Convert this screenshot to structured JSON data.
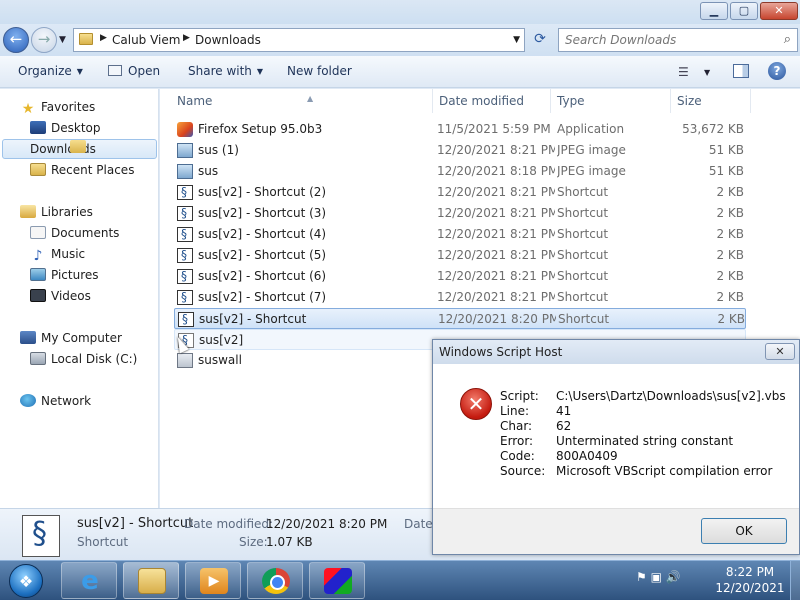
{
  "window": {
    "minimize_glyph": "▁",
    "maximize_glyph": "▢",
    "close_glyph": "✕"
  },
  "address": {
    "crumbs": [
      "Calub Viem",
      "Downloads"
    ],
    "refresh_glyph": "⟳",
    "search_placeholder": "Search Downloads"
  },
  "toolbar": {
    "organize": "Organize",
    "open": "Open",
    "share_with": "Share with",
    "new_folder": "New folder",
    "help_glyph": "?"
  },
  "nav": {
    "favorites": "Favorites",
    "desktop": "Desktop",
    "downloads": "Downloads",
    "recent_places": "Recent Places",
    "libraries": "Libraries",
    "documents": "Documents",
    "music": "Music",
    "pictures": "Pictures",
    "videos": "Videos",
    "my_computer": "My Computer",
    "local_disk": "Local Disk (C:)",
    "network": "Network"
  },
  "columns": {
    "name": "Name",
    "date_modified": "Date modified",
    "type": "Type",
    "size": "Size"
  },
  "files": [
    {
      "name": "Firefox Setup 95.0b3",
      "date": "11/5/2021 5:59 PM",
      "type": "Application",
      "size": "53,672 KB",
      "icon": "firefox-setup-icon"
    },
    {
      "name": "sus (1)",
      "date": "12/20/2021 8:21 PM",
      "type": "JPEG image",
      "size": "51 KB",
      "icon": "jpeg-file-icon"
    },
    {
      "name": "sus",
      "date": "12/20/2021 8:18 PM",
      "type": "JPEG image",
      "size": "51 KB",
      "icon": "jpeg-file-icon"
    },
    {
      "name": "sus[v2] - Shortcut (2)",
      "date": "12/20/2021 8:21 PM",
      "type": "Shortcut",
      "size": "2 KB",
      "icon": "shortcut-script-icon"
    },
    {
      "name": "sus[v2] - Shortcut (3)",
      "date": "12/20/2021 8:21 PM",
      "type": "Shortcut",
      "size": "2 KB",
      "icon": "shortcut-script-icon"
    },
    {
      "name": "sus[v2] - Shortcut (4)",
      "date": "12/20/2021 8:21 PM",
      "type": "Shortcut",
      "size": "2 KB",
      "icon": "shortcut-script-icon"
    },
    {
      "name": "sus[v2] - Shortcut (5)",
      "date": "12/20/2021 8:21 PM",
      "type": "Shortcut",
      "size": "2 KB",
      "icon": "shortcut-script-icon"
    },
    {
      "name": "sus[v2] - Shortcut (6)",
      "date": "12/20/2021 8:21 PM",
      "type": "Shortcut",
      "size": "2 KB",
      "icon": "shortcut-script-icon"
    },
    {
      "name": "sus[v2] - Shortcut (7)",
      "date": "12/20/2021 8:21 PM",
      "type": "Shortcut",
      "size": "2 KB",
      "icon": "shortcut-script-icon"
    },
    {
      "name": "sus[v2] - Shortcut",
      "date": "12/20/2021 8:20 PM",
      "type": "Shortcut",
      "size": "2 KB",
      "icon": "shortcut-script-icon"
    },
    {
      "name": "sus[v2]",
      "date": "",
      "type": "",
      "size": "",
      "icon": "vbscript-file-icon"
    },
    {
      "name": "suswall",
      "date": "",
      "type": "",
      "size": "",
      "icon": "image-file-icon"
    }
  ],
  "details": {
    "name": "sus[v2] - Shortcut",
    "type": "Shortcut",
    "date_label": "Date modified:",
    "date_value": "12/20/2021 8:20 PM",
    "size_label": "Size:",
    "size_value": "1.07 KB",
    "date_label_2": "Date"
  },
  "dialog": {
    "title": "Windows Script Host",
    "close_glyph": "✕",
    "error_glyph": "✕",
    "script_label": "Script:",
    "script_value": "C:\\Users\\Dartz\\Downloads\\sus[v2].vbs",
    "line_label": "Line:",
    "line_value": "41",
    "char_label": "Char:",
    "char_value": "62",
    "error_label": "Error:",
    "error_value": "Unterminated string constant",
    "code_label": "Code:",
    "code_value": "800A0409",
    "source_label": "Source:",
    "source_value": "Microsoft VBScript compilation error",
    "ok": "OK"
  },
  "taskbar": {
    "start_glyph": "❖",
    "ie_glyph": "e",
    "wmp_glyph": "▶",
    "tray_glyphs": "⚑ ▣ 🔊",
    "time": "8:22 PM",
    "date": "12/20/2021"
  }
}
